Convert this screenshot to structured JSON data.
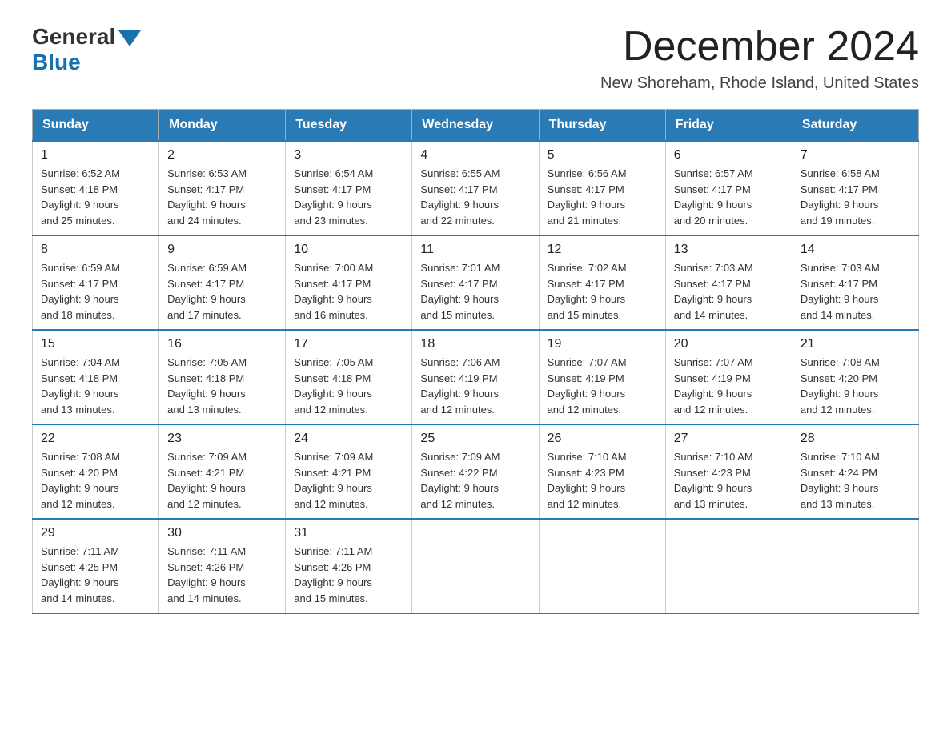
{
  "logo": {
    "general": "General",
    "blue": "Blue"
  },
  "title": {
    "month": "December 2024",
    "location": "New Shoreham, Rhode Island, United States"
  },
  "weekdays": [
    "Sunday",
    "Monday",
    "Tuesday",
    "Wednesday",
    "Thursday",
    "Friday",
    "Saturday"
  ],
  "weeks": [
    [
      {
        "day": "1",
        "sunrise": "6:52 AM",
        "sunset": "4:18 PM",
        "daylight": "9 hours and 25 minutes."
      },
      {
        "day": "2",
        "sunrise": "6:53 AM",
        "sunset": "4:17 PM",
        "daylight": "9 hours and 24 minutes."
      },
      {
        "day": "3",
        "sunrise": "6:54 AM",
        "sunset": "4:17 PM",
        "daylight": "9 hours and 23 minutes."
      },
      {
        "day": "4",
        "sunrise": "6:55 AM",
        "sunset": "4:17 PM",
        "daylight": "9 hours and 22 minutes."
      },
      {
        "day": "5",
        "sunrise": "6:56 AM",
        "sunset": "4:17 PM",
        "daylight": "9 hours and 21 minutes."
      },
      {
        "day": "6",
        "sunrise": "6:57 AM",
        "sunset": "4:17 PM",
        "daylight": "9 hours and 20 minutes."
      },
      {
        "day": "7",
        "sunrise": "6:58 AM",
        "sunset": "4:17 PM",
        "daylight": "9 hours and 19 minutes."
      }
    ],
    [
      {
        "day": "8",
        "sunrise": "6:59 AM",
        "sunset": "4:17 PM",
        "daylight": "9 hours and 18 minutes."
      },
      {
        "day": "9",
        "sunrise": "6:59 AM",
        "sunset": "4:17 PM",
        "daylight": "9 hours and 17 minutes."
      },
      {
        "day": "10",
        "sunrise": "7:00 AM",
        "sunset": "4:17 PM",
        "daylight": "9 hours and 16 minutes."
      },
      {
        "day": "11",
        "sunrise": "7:01 AM",
        "sunset": "4:17 PM",
        "daylight": "9 hours and 15 minutes."
      },
      {
        "day": "12",
        "sunrise": "7:02 AM",
        "sunset": "4:17 PM",
        "daylight": "9 hours and 15 minutes."
      },
      {
        "day": "13",
        "sunrise": "7:03 AM",
        "sunset": "4:17 PM",
        "daylight": "9 hours and 14 minutes."
      },
      {
        "day": "14",
        "sunrise": "7:03 AM",
        "sunset": "4:17 PM",
        "daylight": "9 hours and 14 minutes."
      }
    ],
    [
      {
        "day": "15",
        "sunrise": "7:04 AM",
        "sunset": "4:18 PM",
        "daylight": "9 hours and 13 minutes."
      },
      {
        "day": "16",
        "sunrise": "7:05 AM",
        "sunset": "4:18 PM",
        "daylight": "9 hours and 13 minutes."
      },
      {
        "day": "17",
        "sunrise": "7:05 AM",
        "sunset": "4:18 PM",
        "daylight": "9 hours and 12 minutes."
      },
      {
        "day": "18",
        "sunrise": "7:06 AM",
        "sunset": "4:19 PM",
        "daylight": "9 hours and 12 minutes."
      },
      {
        "day": "19",
        "sunrise": "7:07 AM",
        "sunset": "4:19 PM",
        "daylight": "9 hours and 12 minutes."
      },
      {
        "day": "20",
        "sunrise": "7:07 AM",
        "sunset": "4:19 PM",
        "daylight": "9 hours and 12 minutes."
      },
      {
        "day": "21",
        "sunrise": "7:08 AM",
        "sunset": "4:20 PM",
        "daylight": "9 hours and 12 minutes."
      }
    ],
    [
      {
        "day": "22",
        "sunrise": "7:08 AM",
        "sunset": "4:20 PM",
        "daylight": "9 hours and 12 minutes."
      },
      {
        "day": "23",
        "sunrise": "7:09 AM",
        "sunset": "4:21 PM",
        "daylight": "9 hours and 12 minutes."
      },
      {
        "day": "24",
        "sunrise": "7:09 AM",
        "sunset": "4:21 PM",
        "daylight": "9 hours and 12 minutes."
      },
      {
        "day": "25",
        "sunrise": "7:09 AM",
        "sunset": "4:22 PM",
        "daylight": "9 hours and 12 minutes."
      },
      {
        "day": "26",
        "sunrise": "7:10 AM",
        "sunset": "4:23 PM",
        "daylight": "9 hours and 12 minutes."
      },
      {
        "day": "27",
        "sunrise": "7:10 AM",
        "sunset": "4:23 PM",
        "daylight": "9 hours and 13 minutes."
      },
      {
        "day": "28",
        "sunrise": "7:10 AM",
        "sunset": "4:24 PM",
        "daylight": "9 hours and 13 minutes."
      }
    ],
    [
      {
        "day": "29",
        "sunrise": "7:11 AM",
        "sunset": "4:25 PM",
        "daylight": "9 hours and 14 minutes."
      },
      {
        "day": "30",
        "sunrise": "7:11 AM",
        "sunset": "4:26 PM",
        "daylight": "9 hours and 14 minutes."
      },
      {
        "day": "31",
        "sunrise": "7:11 AM",
        "sunset": "4:26 PM",
        "daylight": "9 hours and 15 minutes."
      },
      null,
      null,
      null,
      null
    ]
  ],
  "labels": {
    "sunrise": "Sunrise:",
    "sunset": "Sunset:",
    "daylight": "Daylight:"
  }
}
